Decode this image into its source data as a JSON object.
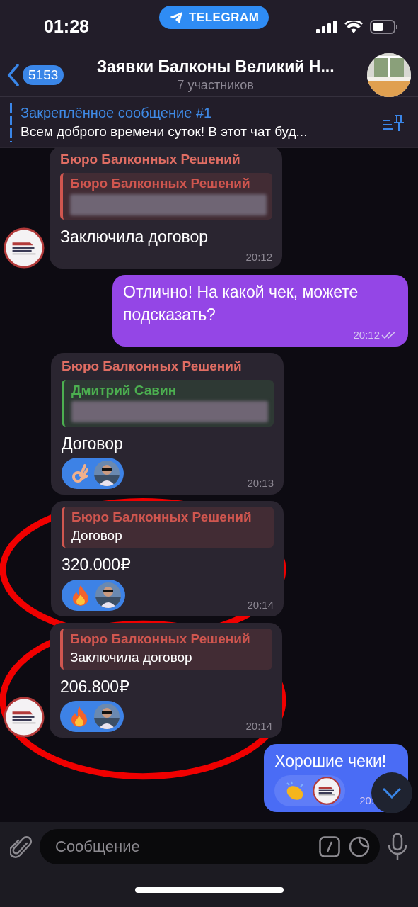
{
  "status_bar": {
    "time": "01:28",
    "app_pill": "TELEGRAM"
  },
  "header": {
    "back_count": "5153",
    "title": "Заявки Балконы Великий Н...",
    "subtitle": "7 участников"
  },
  "pinned": {
    "title": "Закреплённое сообщение #1",
    "text": "Всем доброго времени суток! В этот чат буд..."
  },
  "messages": [
    {
      "kind": "incoming",
      "avatar": true,
      "highlighted": false,
      "sender": "Бюро Балконных Решений",
      "reply": {
        "author": "Бюро Балконных Решений",
        "color": "#d0564f",
        "blurred": true
      },
      "text": "Заключила договор",
      "time": "20:12"
    },
    {
      "kind": "outgoing",
      "color": "#9446e6",
      "highlighted": false,
      "read": true,
      "text": "Отлично! На какой чек, можете подсказать?",
      "time": "20:12"
    },
    {
      "kind": "incoming",
      "avatar": false,
      "highlighted": false,
      "sender": "Бюро Балконных Решений",
      "reply": {
        "author": "Дмитрий Савин",
        "color": "#4caf50",
        "blurred": true
      },
      "text": "Договор",
      "reactions": [
        {
          "kind": "ok_hand"
        }
      ],
      "time": "20:13"
    },
    {
      "kind": "incoming",
      "avatar": false,
      "highlighted": true,
      "reply": {
        "author": "Бюро Балконных Решений",
        "color": "#d0564f",
        "blurred": false,
        "text": "Договор"
      },
      "text": "320.000₽",
      "reactions": [
        {
          "kind": "fire"
        }
      ],
      "time": "20:14"
    },
    {
      "kind": "incoming",
      "avatar": true,
      "highlighted": true,
      "reply": {
        "author": "Бюро Балконных Решений",
        "color": "#d0564f",
        "blurred": false,
        "text": "Заключила договор"
      },
      "text": "206.800₽",
      "reactions": [
        {
          "kind": "fire"
        }
      ],
      "time": "20:14"
    },
    {
      "kind": "outgoing",
      "color": "#4a6cf5",
      "highlighted": false,
      "read": false,
      "text": "Хорошие чеки!",
      "reactions": [
        {
          "kind": "clap",
          "reactor": {
            "kind": "logo"
          }
        }
      ],
      "time": "20:"
    }
  ],
  "input": {
    "placeholder": "Сообщение"
  }
}
